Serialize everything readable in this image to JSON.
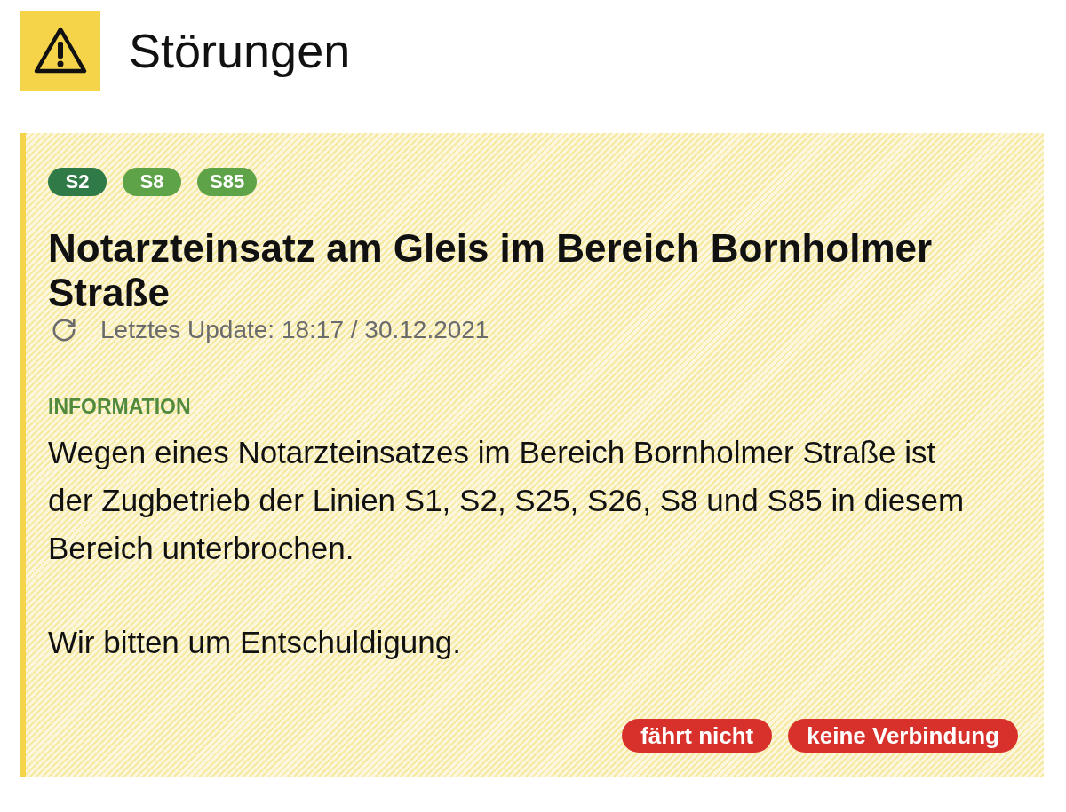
{
  "header": {
    "title": "Störungen"
  },
  "disruption": {
    "lines": [
      {
        "label": "S2",
        "color": "#2f7a46"
      },
      {
        "label": "S8",
        "color": "#5ea348"
      },
      {
        "label": "S85",
        "color": "#5ea348"
      }
    ],
    "title": "Notarzteinsatz am Gleis im Bereich Bornholmer Straße",
    "update": "Letztes Update: 18:17 / 30.12.2021",
    "information": {
      "label": "INFORMATION",
      "paragraphs": [
        "Wegen eines Notarzteinsatzes im Bereich Bornholmer Straße ist der Zugbetrieb der Linien S1, S2, S25, S26, S8 und S85 in diesem Bereich unterbrochen.",
        "Wir bitten um Entschuldigung."
      ]
    },
    "tags": [
      "fährt nicht",
      "keine Verbindung"
    ]
  }
}
